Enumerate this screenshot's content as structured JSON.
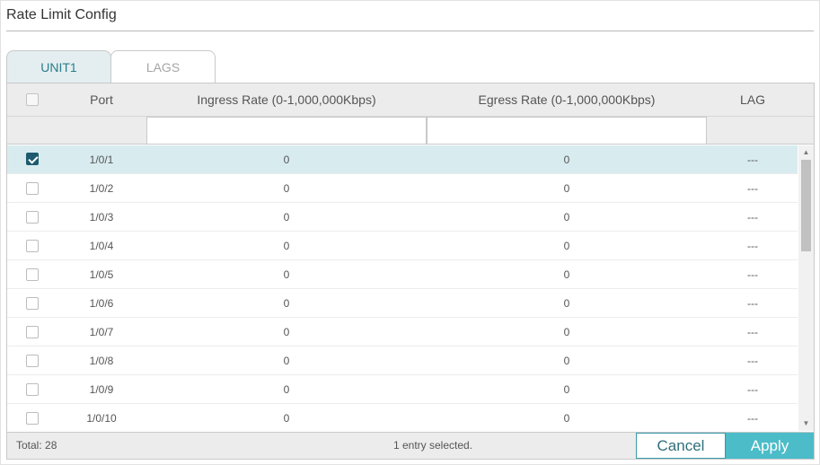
{
  "page": {
    "title": "Rate Limit Config"
  },
  "tabs": [
    {
      "label": "UNIT1",
      "active": true
    },
    {
      "label": "LAGS",
      "active": false
    }
  ],
  "table": {
    "columns": {
      "port": "Port",
      "ingress": "Ingress Rate (0-1,000,000Kbps)",
      "egress": "Egress Rate (0-1,000,000Kbps)",
      "lag": "LAG"
    },
    "filters": {
      "ingress": "",
      "egress": ""
    },
    "rows": [
      {
        "port": "1/0/1",
        "ingress": "0",
        "egress": "0",
        "lag": "---",
        "checked": true
      },
      {
        "port": "1/0/2",
        "ingress": "0",
        "egress": "0",
        "lag": "---",
        "checked": false
      },
      {
        "port": "1/0/3",
        "ingress": "0",
        "egress": "0",
        "lag": "---",
        "checked": false
      },
      {
        "port": "1/0/4",
        "ingress": "0",
        "egress": "0",
        "lag": "---",
        "checked": false
      },
      {
        "port": "1/0/5",
        "ingress": "0",
        "egress": "0",
        "lag": "---",
        "checked": false
      },
      {
        "port": "1/0/6",
        "ingress": "0",
        "egress": "0",
        "lag": "---",
        "checked": false
      },
      {
        "port": "1/0/7",
        "ingress": "0",
        "egress": "0",
        "lag": "---",
        "checked": false
      },
      {
        "port": "1/0/8",
        "ingress": "0",
        "egress": "0",
        "lag": "---",
        "checked": false
      },
      {
        "port": "1/0/9",
        "ingress": "0",
        "egress": "0",
        "lag": "---",
        "checked": false
      },
      {
        "port": "1/0/10",
        "ingress": "0",
        "egress": "0",
        "lag": "---",
        "checked": false
      }
    ]
  },
  "footer": {
    "total": "Total: 28",
    "status": "1 entry selected.",
    "cancel_label": "Cancel",
    "apply_label": "Apply"
  },
  "colors": {
    "accent": "#4bbcc8",
    "selected_row": "#d8ecef",
    "checkbox_checked": "#1e5b6e"
  },
  "icons": {
    "scroll_up": "scroll-up-arrow-icon",
    "scroll_down": "scroll-down-arrow-icon",
    "checkmark": "checkmark-icon"
  }
}
